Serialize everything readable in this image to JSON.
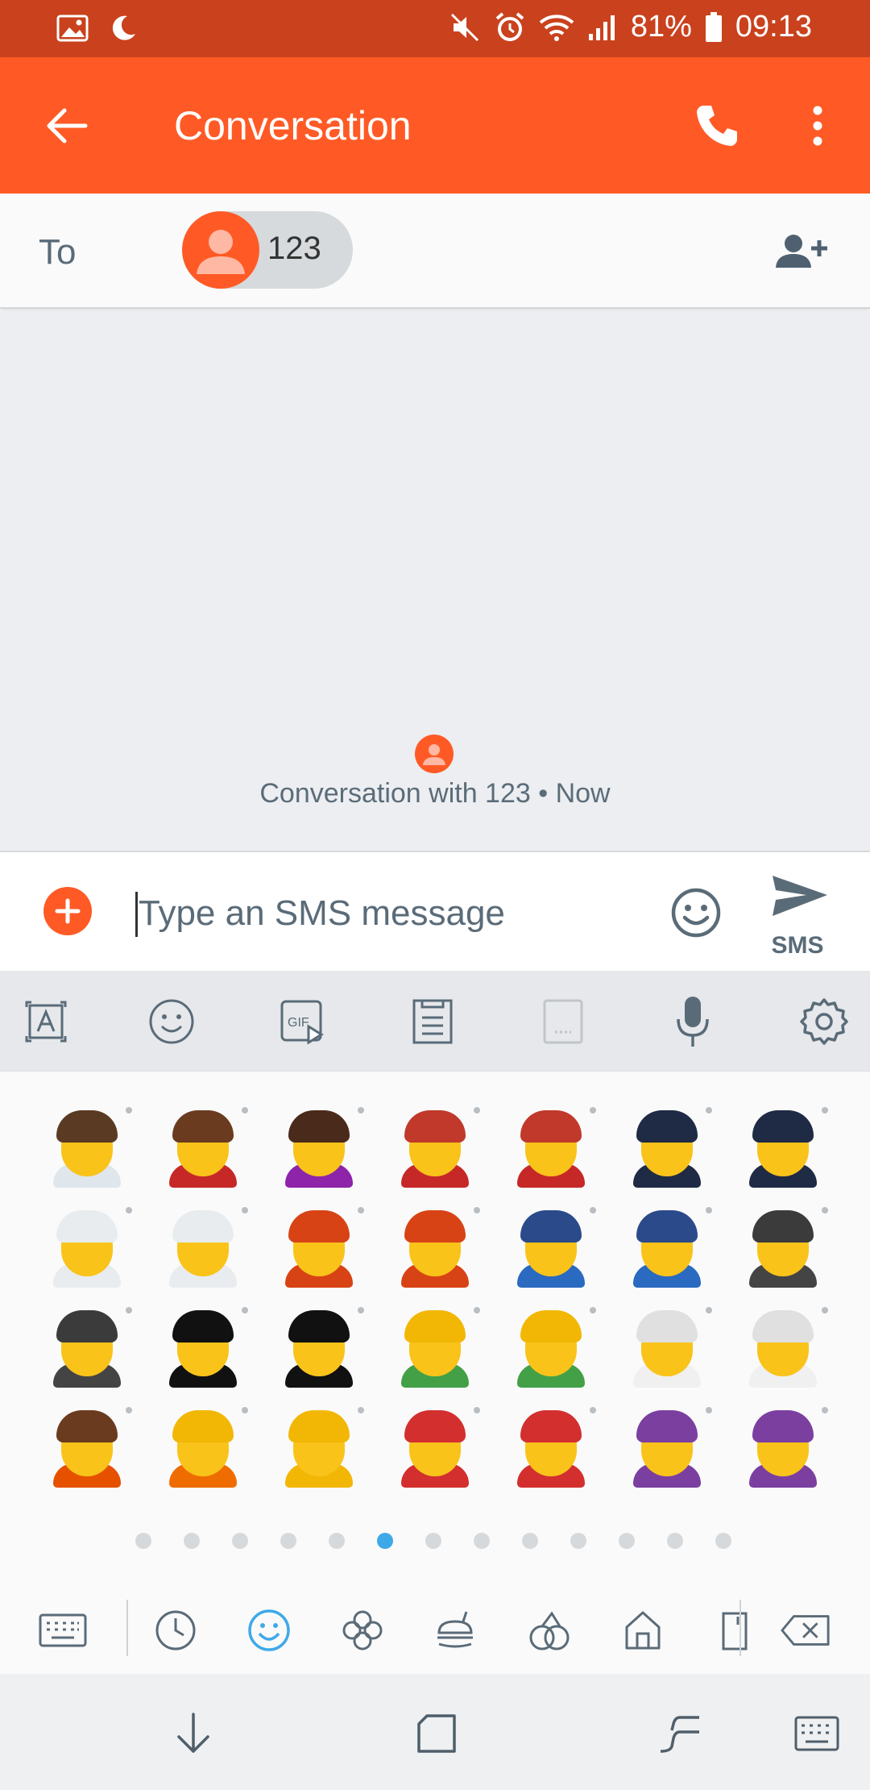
{
  "status_bar": {
    "battery": "81%",
    "time": "09:13"
  },
  "app_bar": {
    "title": "Conversation"
  },
  "recipients": {
    "to_label": "To",
    "chips": [
      {
        "label": "123"
      }
    ]
  },
  "conversation": {
    "info": "Conversation with 123 • Now"
  },
  "composer": {
    "placeholder": "Type an SMS message",
    "send_label": "SMS"
  },
  "keyboard_toolbar": {
    "tools": [
      "text-edit-icon",
      "emoji-icon",
      "gif-icon",
      "clipboard-icon",
      "one-hand-keyboard-icon",
      "microphone-icon",
      "settings-icon"
    ]
  },
  "emoji_panel": {
    "emojis": [
      "woman-technologist",
      "man-singer",
      "woman-singer",
      "man-artist",
      "woman-artist",
      "man-pilot",
      "woman-pilot",
      "man-astronaut",
      "woman-astronaut",
      "man-firefighter",
      "woman-firefighter",
      "man-police-officer",
      "woman-police-officer",
      "man-detective",
      "woman-detective",
      "man-guard",
      "woman-guard",
      "man-construction-worker",
      "woman-construction-worker",
      "man-wearing-turban",
      "woman-wearing-turban",
      "bearded-person",
      "blond-man",
      "blond-woman",
      "santa-claus",
      "mrs-claus",
      "man-mage",
      "woman-mage"
    ],
    "page_count": 13,
    "active_page": 5,
    "categories": [
      "keyboard-icon",
      "recent-icon",
      "smileys-icon",
      "nature-icon",
      "food-icon",
      "activity-icon",
      "places-icon",
      "objects-icon",
      "backspace-icon"
    ]
  },
  "nav_bar": {
    "buttons": [
      "hide-keyboard-icon",
      "recents-icon",
      "back-icon",
      "keyboard-switch-icon"
    ]
  },
  "colors": {
    "status_bar": "#c9421d",
    "accent": "#ff5a26",
    "active_blue": "#3fa9e8"
  }
}
